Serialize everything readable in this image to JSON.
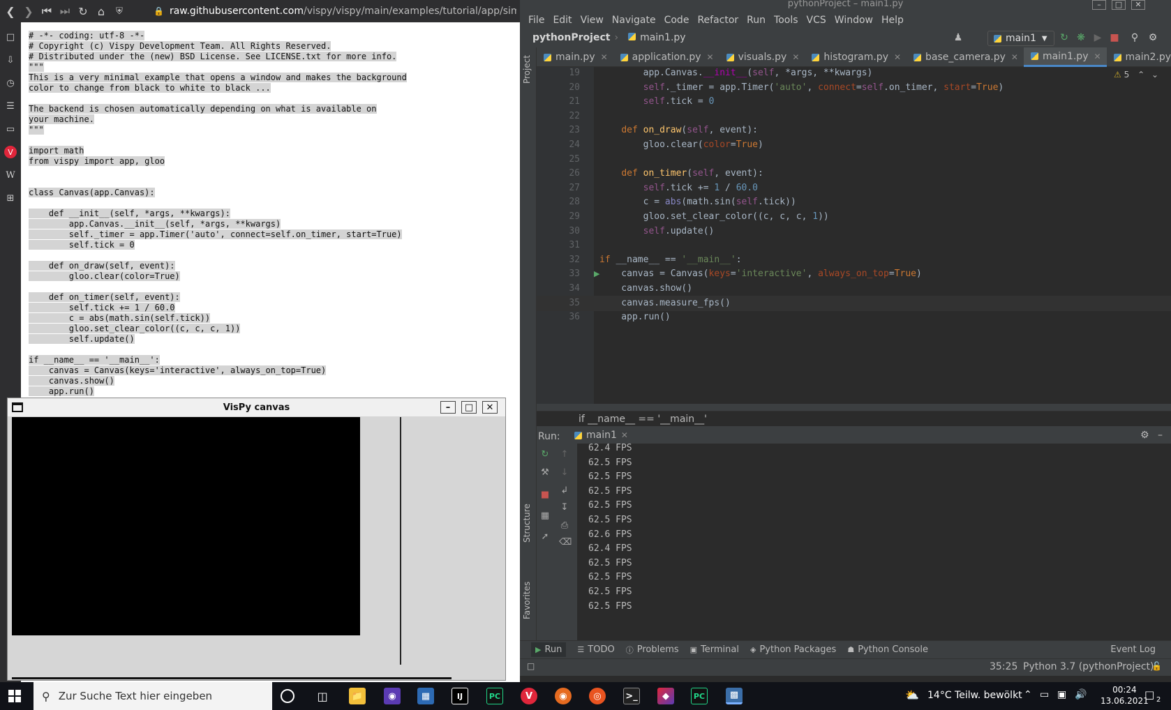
{
  "browser": {
    "url_domain": "raw.githubusercontent.com",
    "url_path": "/vispy/vispy/main/examples/tutorial/app/simple.py",
    "raw_code_lines": [
      "# -*- coding: utf-8 -*-",
      "# Copyright (c) Vispy Development Team. All Rights Reserved.",
      "# Distributed under the (new) BSD License. See LICENSE.txt for more info.",
      "\"\"\"",
      "This is a very minimal example that opens a window and makes the background",
      "color to change from black to white to black ...",
      "",
      "The backend is chosen automatically depending on what is available on",
      "your machine.",
      "\"\"\"",
      "",
      "import math",
      "from vispy import app, gloo",
      "",
      "",
      "class Canvas(app.Canvas):",
      "",
      "    def __init__(self, *args, **kwargs):",
      "        app.Canvas.__init__(self, *args, **kwargs)",
      "        self._timer = app.Timer('auto', connect=self.on_timer, start=True)",
      "        self.tick = 0",
      "",
      "    def on_draw(self, event):",
      "        gloo.clear(color=True)",
      "",
      "    def on_timer(self, event):",
      "        self.tick += 1 / 60.0",
      "        c = abs(math.sin(self.tick))",
      "        gloo.set_clear_color((c, c, c, 1))",
      "        self.update()",
      "",
      "if __name__ == '__main__':",
      "    canvas = Canvas(keys='interactive', always_on_top=True)",
      "    canvas.show()",
      "    app.run()"
    ]
  },
  "vispy_window": {
    "title": "VisPy canvas"
  },
  "ide": {
    "window_title": "pythonProject – main1.py",
    "menu": [
      "File",
      "Edit",
      "View",
      "Navigate",
      "Code",
      "Refactor",
      "Run",
      "Tools",
      "VCS",
      "Window",
      "Help"
    ],
    "nav_project": "pythonProject",
    "nav_file": "main1.py",
    "run_config": "main1",
    "tabs": [
      "main.py",
      "application.py",
      "visuals.py",
      "histogram.py",
      "base_camera.py",
      "main1.py",
      "main2.py"
    ],
    "active_tab": "main1.py",
    "warning_count": "5",
    "side_labels": {
      "project": "Project",
      "structure": "Structure",
      "favorites": "Favorites"
    },
    "editor_lines": [
      {
        "n": "19",
        "html": "        app.Canvas.<span class=\"mg\">__init__</span>(<span class=\"sf\">self</span>, *args, **kwargs)"
      },
      {
        "n": "20",
        "html": "        <span class=\"sf\">self</span>._timer = app.Timer(<span class=\"st\">'auto'</span>, <span class=\"pm\">connect</span>=<span class=\"sf\">self</span>.on_timer, <span class=\"pm\">start</span>=<span class=\"kw\">True</span>)"
      },
      {
        "n": "21",
        "html": "        <span class=\"sf\">self</span>.tick = <span class=\"nm\">0</span>"
      },
      {
        "n": "22",
        "html": ""
      },
      {
        "n": "23",
        "html": "    <span class=\"kw\">def</span> <span class=\"fn\">on_draw</span>(<span class=\"sf\">self</span>, event):"
      },
      {
        "n": "24",
        "html": "        gloo.clear(<span class=\"pm\">color</span>=<span class=\"kw\">True</span>)"
      },
      {
        "n": "25",
        "html": ""
      },
      {
        "n": "26",
        "html": "    <span class=\"kw\">def</span> <span class=\"fn\">on_timer</span>(<span class=\"sf\">self</span>, event):"
      },
      {
        "n": "27",
        "html": "        <span class=\"sf\">self</span>.tick += <span class=\"nm\">1</span> / <span class=\"nm\">60.0</span>"
      },
      {
        "n": "28",
        "html": "        c = <span class=\"bi\">abs</span>(math.sin(<span class=\"sf\">self</span>.tick))"
      },
      {
        "n": "29",
        "html": "        gloo.set_clear_color((c, c, c, <span class=\"nm\">1</span>))"
      },
      {
        "n": "30",
        "html": "        <span class=\"sf\">self</span>.update()"
      },
      {
        "n": "31",
        "html": ""
      },
      {
        "n": "32",
        "html": "<span class=\"kw\">if</span> __name__ == <span class=\"st\">'__main__'</span>:"
      },
      {
        "n": "33",
        "html": "    canvas = Canvas(<span class=\"pm\">keys</span>=<span class=\"st\">'interactive'</span>, <span class=\"pm\">always_on_top</span>=<span class=\"kw\">True</span>)"
      },
      {
        "n": "34",
        "html": "    canvas.show()"
      },
      {
        "n": "35",
        "html": "    canvas.measure_fps()"
      },
      {
        "n": "36",
        "html": "    app.run()"
      }
    ],
    "current_line": "35",
    "breadcrumb": "if __name__ == '__main__'",
    "run_label": "Run:",
    "run_tab": "main1",
    "fps_lines": [
      "62.4 FPS",
      "62.5 FPS",
      "62.5 FPS",
      "62.5 FPS",
      "62.5 FPS",
      "62.5 FPS",
      "62.6 FPS",
      "62.4 FPS",
      "62.5 FPS",
      "62.5 FPS",
      "62.5 FPS",
      "62.5 FPS"
    ],
    "bottom_tabs": [
      "Run",
      "TODO",
      "Problems",
      "Terminal",
      "Python Packages",
      "Python Console"
    ],
    "event_log": "Event Log",
    "status_pos": "35:25",
    "status_interpreter": "Python 3.7 (pythonProject)"
  },
  "taskbar": {
    "search_placeholder": "Zur Suche Text hier eingeben",
    "weather": "14°C  Teilw. bewölkt",
    "time": "00:24",
    "date": "13.06.2021",
    "notification_count": "2"
  },
  "colors": {
    "accent": "#4a88c7",
    "ide_bg": "#2b2b2b",
    "taskbar": "#101218"
  }
}
